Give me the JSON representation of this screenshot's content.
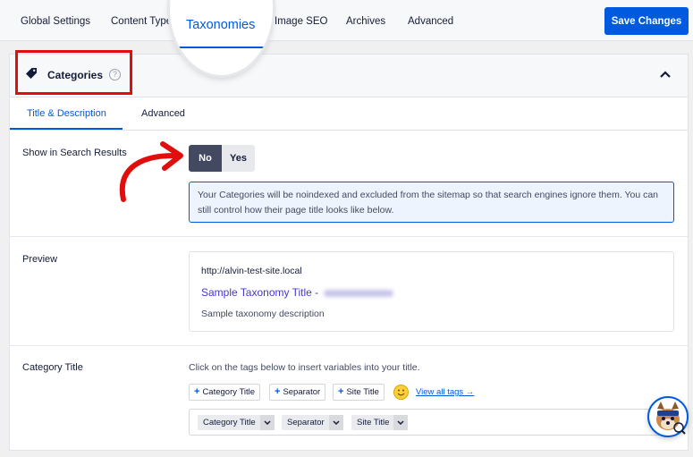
{
  "nav": {
    "tabs": [
      {
        "label": "Global Settings"
      },
      {
        "label": "Content Types"
      },
      {
        "label": "Taxonomies",
        "active": true
      },
      {
        "label": "Image SEO"
      },
      {
        "label": "Archives"
      },
      {
        "label": "Advanced"
      }
    ],
    "save_label": "Save Changes"
  },
  "card": {
    "title": "Categories",
    "help_icon": "?",
    "subtabs": [
      {
        "label": "Title & Description",
        "active": true
      },
      {
        "label": "Advanced"
      }
    ]
  },
  "search_results": {
    "label": "Show in Search Results",
    "options": [
      "No",
      "Yes"
    ],
    "selected": "No",
    "notice": "Your Categories will be noindexed and excluded from the sitemap so that search engines ignore them. You can still control how their page title looks like below."
  },
  "preview": {
    "label": "Preview",
    "url": "http://alvin-test-site.local",
    "title": "Sample Taxonomy Title -",
    "description": "Sample taxonomy description"
  },
  "category_title": {
    "label": "Category Title",
    "hint": "Click on the tags below to insert variables into your title.",
    "tag_buttons": [
      "Category Title",
      "Separator",
      "Site Title"
    ],
    "view_all": "View all tags →",
    "chips": [
      "Category Title",
      "Separator",
      "Site Title"
    ]
  },
  "colors": {
    "accent": "#005ae0",
    "annotation": "#e10e0e",
    "toggle_active": "#434960"
  },
  "icons": [
    "tag-icon",
    "help-icon",
    "chevron-up-icon",
    "curved-arrow-icon",
    "chevron-down-icon",
    "smiley-icon",
    "mascot-icon"
  ]
}
